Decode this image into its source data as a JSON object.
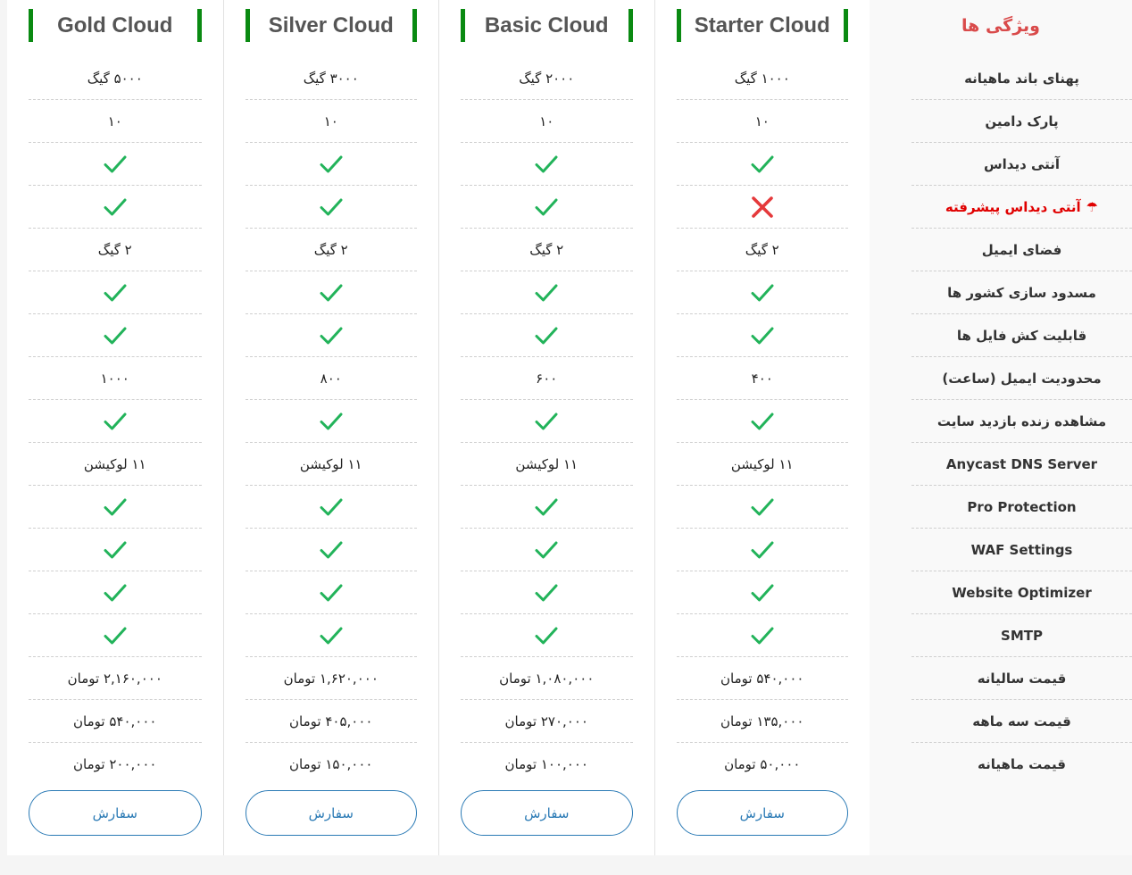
{
  "colors": {
    "accent_green": "#0a8a12",
    "check": "#22b35a",
    "cross": "#e5393b",
    "button": "#2a7ab5",
    "feature_title": "#d94a4a",
    "highlight": "#e00000"
  },
  "features": {
    "title": "ویژگی ها",
    "items": [
      {
        "label": "پهنای باند ماهیانه"
      },
      {
        "label": "پارک دامین"
      },
      {
        "label": "آنتی دیداس"
      },
      {
        "label": "آنتی دیداس پیشرفته",
        "highlight": true,
        "icon": "umbrella-icon",
        "glyph": "☂"
      },
      {
        "label": "فضای ایمیل"
      },
      {
        "label": "مسدود سازی کشور ها"
      },
      {
        "label": "قابلیت کش فایل ها"
      },
      {
        "label": "محدودیت ایمیل (ساعت)"
      },
      {
        "label": "مشاهده زنده بازدید سایت"
      },
      {
        "label": "Anycast DNS Server",
        "ltr": true
      },
      {
        "label": "Pro Protection",
        "ltr": true
      },
      {
        "label": "WAF Settings",
        "ltr": true
      },
      {
        "label": "Website Optimizer",
        "ltr": true
      },
      {
        "label": "SMTP",
        "ltr": true
      },
      {
        "label": "قیمت سالیانه"
      },
      {
        "label": "قیمت سه ماهه"
      },
      {
        "label": "قیمت ماهیانه"
      }
    ]
  },
  "plans": [
    {
      "name": "Gold Cloud",
      "order_label": "سفارش",
      "values": [
        {
          "text": "۵۰۰۰ گیگ"
        },
        {
          "text": "۱۰"
        },
        {
          "icon": "check"
        },
        {
          "icon": "check"
        },
        {
          "text": "۲ گیگ"
        },
        {
          "icon": "check"
        },
        {
          "icon": "check"
        },
        {
          "text": "۱۰۰۰"
        },
        {
          "icon": "check"
        },
        {
          "text": "۱۱ لوکیشن"
        },
        {
          "icon": "check"
        },
        {
          "icon": "check"
        },
        {
          "icon": "check"
        },
        {
          "icon": "check"
        },
        {
          "text": "۲,۱۶۰,۰۰۰ تومان"
        },
        {
          "text": "۵۴۰,۰۰۰ تومان"
        },
        {
          "text": "۲۰۰,۰۰۰ تومان"
        }
      ]
    },
    {
      "name": "Silver Cloud",
      "order_label": "سفارش",
      "values": [
        {
          "text": "۳۰۰۰ گیگ"
        },
        {
          "text": "۱۰"
        },
        {
          "icon": "check"
        },
        {
          "icon": "check"
        },
        {
          "text": "۲ گیگ"
        },
        {
          "icon": "check"
        },
        {
          "icon": "check"
        },
        {
          "text": "۸۰۰"
        },
        {
          "icon": "check"
        },
        {
          "text": "۱۱ لوکیشن"
        },
        {
          "icon": "check"
        },
        {
          "icon": "check"
        },
        {
          "icon": "check"
        },
        {
          "icon": "check"
        },
        {
          "text": "۱,۶۲۰,۰۰۰ تومان"
        },
        {
          "text": "۴۰۵,۰۰۰ تومان"
        },
        {
          "text": "۱۵۰,۰۰۰ تومان"
        }
      ]
    },
    {
      "name": "Basic Cloud",
      "order_label": "سفارش",
      "values": [
        {
          "text": "۲۰۰۰ گیگ"
        },
        {
          "text": "۱۰"
        },
        {
          "icon": "check"
        },
        {
          "icon": "check"
        },
        {
          "text": "۲ گیگ"
        },
        {
          "icon": "check"
        },
        {
          "icon": "check"
        },
        {
          "text": "۶۰۰"
        },
        {
          "icon": "check"
        },
        {
          "text": "۱۱ لوکیشن"
        },
        {
          "icon": "check"
        },
        {
          "icon": "check"
        },
        {
          "icon": "check"
        },
        {
          "icon": "check"
        },
        {
          "text": "۱,۰۸۰,۰۰۰ تومان"
        },
        {
          "text": "۲۷۰,۰۰۰ تومان"
        },
        {
          "text": "۱۰۰,۰۰۰ تومان"
        }
      ]
    },
    {
      "name": "Starter Cloud",
      "order_label": "سفارش",
      "values": [
        {
          "text": "۱۰۰۰ گیگ"
        },
        {
          "text": "۱۰"
        },
        {
          "icon": "check"
        },
        {
          "icon": "cross"
        },
        {
          "text": "۲ گیگ"
        },
        {
          "icon": "check"
        },
        {
          "icon": "check"
        },
        {
          "text": "۴۰۰"
        },
        {
          "icon": "check"
        },
        {
          "text": "۱۱ لوکیشن"
        },
        {
          "icon": "check"
        },
        {
          "icon": "check"
        },
        {
          "icon": "check"
        },
        {
          "icon": "check"
        },
        {
          "text": "۵۴۰,۰۰۰ تومان"
        },
        {
          "text": "۱۳۵,۰۰۰ تومان"
        },
        {
          "text": "۵۰,۰۰۰ تومان"
        }
      ]
    }
  ]
}
